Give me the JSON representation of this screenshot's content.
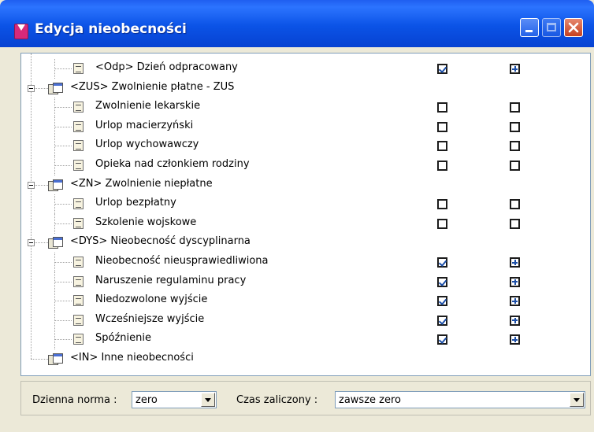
{
  "window": {
    "title": "Edycja nieobecności"
  },
  "tree": {
    "rows": [
      {
        "type": "item",
        "label": "<Odp> Dzień odpracowany",
        "checked": true,
        "extra": "plus"
      },
      {
        "type": "group",
        "label": "<ZUS> Zwolnienie płatne - ZUS"
      },
      {
        "type": "item",
        "label": "Zwolnienie lekarskie",
        "checked": false,
        "extra": "empty"
      },
      {
        "type": "item",
        "label": "Urlop macierzyński",
        "checked": false,
        "extra": "empty"
      },
      {
        "type": "item",
        "label": "Urlop wychowawczy",
        "checked": false,
        "extra": "empty"
      },
      {
        "type": "item",
        "label": "Opieka nad członkiem rodziny",
        "checked": false,
        "extra": "empty"
      },
      {
        "type": "group",
        "label": "<ZN> Zwolnienie niepłatne"
      },
      {
        "type": "item",
        "label": "Urlop bezpłatny",
        "checked": false,
        "extra": "empty"
      },
      {
        "type": "item",
        "label": "Szkolenie wojskowe",
        "checked": false,
        "extra": "empty"
      },
      {
        "type": "group",
        "label": "<DYS> Nieobecność dyscyplinarna"
      },
      {
        "type": "item",
        "label": "Nieobecność nieusprawiedliwiona",
        "checked": true,
        "extra": "plus"
      },
      {
        "type": "item",
        "label": "Naruszenie regulaminu pracy",
        "checked": true,
        "extra": "plus"
      },
      {
        "type": "item",
        "label": "Niedozwolone wyjście",
        "checked": true,
        "extra": "plus"
      },
      {
        "type": "item",
        "label": "Wcześniejsze wyjście",
        "checked": true,
        "extra": "plus"
      },
      {
        "type": "item",
        "label": "Spóźnienie",
        "checked": true,
        "extra": "plus"
      },
      {
        "type": "leafgroup",
        "label": "<IN> Inne nieobecności"
      }
    ]
  },
  "bottom": {
    "norm_label": "Dzienna norma :",
    "norm_value": "zero",
    "credit_label": "Czas zaliczony :",
    "credit_value": "zawsze zero"
  },
  "colors": {
    "titlebar": "#0b53e6",
    "check": "#1c4fa8"
  }
}
